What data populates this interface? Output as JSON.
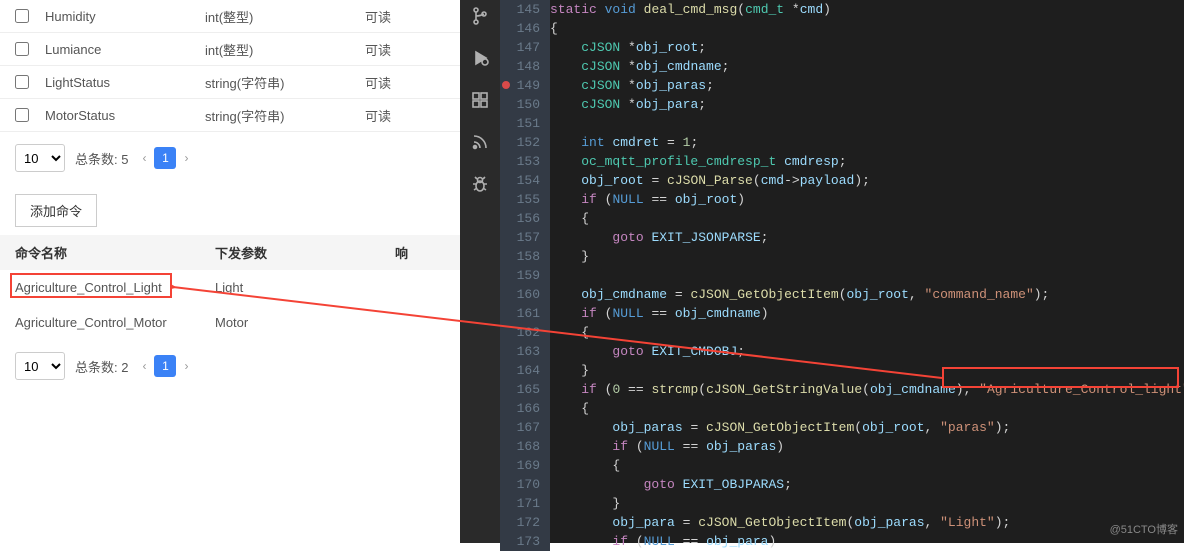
{
  "properties": [
    {
      "name": "Humidity",
      "type": "int(整型)",
      "mode": "可读"
    },
    {
      "name": "Lumiance",
      "type": "int(整型)",
      "mode": "可读"
    },
    {
      "name": "LightStatus",
      "type": "string(字符串)",
      "mode": "可读"
    },
    {
      "name": "MotorStatus",
      "type": "string(字符串)",
      "mode": "可读"
    }
  ],
  "prop_pager": {
    "size": "10",
    "label": "总条数: 5",
    "page": "1"
  },
  "add_cmd_label": "添加命令",
  "cmd_headers": {
    "h1": "命令名称",
    "h2": "下发参数",
    "h3": "响"
  },
  "commands": [
    {
      "name": "Agriculture_Control_Light",
      "param": "Light"
    },
    {
      "name": "Agriculture_Control_Motor",
      "param": "Motor"
    }
  ],
  "cmd_pager": {
    "size": "10",
    "label": "总条数: 2",
    "page": "1"
  },
  "sidebar_icons": [
    "branch",
    "debug",
    "extensions",
    "feed",
    "insect"
  ],
  "breakpoint_line": 149,
  "code": {
    "start": 145,
    "lines": [
      [
        [
          "k",
          "static"
        ],
        [
          "p",
          " "
        ],
        [
          "t",
          "void"
        ],
        [
          "p",
          " "
        ],
        [
          "fn",
          "deal_cmd_msg"
        ],
        [
          "p",
          "("
        ],
        [
          "st",
          "cmd_t"
        ],
        [
          "p",
          " *"
        ],
        [
          "id",
          "cmd"
        ],
        [
          "p",
          ")"
        ]
      ],
      [
        [
          "p",
          "{"
        ]
      ],
      [
        [
          "p",
          "    "
        ],
        [
          "st",
          "cJSON"
        ],
        [
          "p",
          " *"
        ],
        [
          "id",
          "obj_root"
        ],
        [
          "p",
          ";"
        ]
      ],
      [
        [
          "p",
          "    "
        ],
        [
          "st",
          "cJSON"
        ],
        [
          "p",
          " *"
        ],
        [
          "id",
          "obj_cmdname"
        ],
        [
          "p",
          ";"
        ]
      ],
      [
        [
          "p",
          "    "
        ],
        [
          "st",
          "cJSON"
        ],
        [
          "p",
          " *"
        ],
        [
          "id",
          "obj_paras"
        ],
        [
          "p",
          ";"
        ]
      ],
      [
        [
          "p",
          "    "
        ],
        [
          "st",
          "cJSON"
        ],
        [
          "p",
          " *"
        ],
        [
          "id",
          "obj_para"
        ],
        [
          "p",
          ";"
        ]
      ],
      [],
      [
        [
          "p",
          "    "
        ],
        [
          "t",
          "int"
        ],
        [
          "p",
          " "
        ],
        [
          "id",
          "cmdret"
        ],
        [
          "p",
          " = "
        ],
        [
          "n",
          "1"
        ],
        [
          "p",
          ";"
        ]
      ],
      [
        [
          "p",
          "    "
        ],
        [
          "st",
          "oc_mqtt_profile_cmdresp_t"
        ],
        [
          "p",
          " "
        ],
        [
          "id",
          "cmdresp"
        ],
        [
          "p",
          ";"
        ]
      ],
      [
        [
          "p",
          "    "
        ],
        [
          "id",
          "obj_root"
        ],
        [
          "p",
          " = "
        ],
        [
          "fn",
          "cJSON_Parse"
        ],
        [
          "p",
          "("
        ],
        [
          "id",
          "cmd"
        ],
        [
          "p",
          "->"
        ],
        [
          "id",
          "payload"
        ],
        [
          "p",
          ");"
        ]
      ],
      [
        [
          "p",
          "    "
        ],
        [
          "k",
          "if"
        ],
        [
          "p",
          " ("
        ],
        [
          "t",
          "NULL"
        ],
        [
          "p",
          " == "
        ],
        [
          "id",
          "obj_root"
        ],
        [
          "p",
          ")"
        ]
      ],
      [
        [
          "p",
          "    {"
        ]
      ],
      [
        [
          "p",
          "        "
        ],
        [
          "k",
          "goto"
        ],
        [
          "p",
          " "
        ],
        [
          "id",
          "EXIT_JSONPARSE"
        ],
        [
          "p",
          ";"
        ]
      ],
      [
        [
          "p",
          "    }"
        ]
      ],
      [],
      [
        [
          "p",
          "    "
        ],
        [
          "id",
          "obj_cmdname"
        ],
        [
          "p",
          " = "
        ],
        [
          "fn",
          "cJSON_GetObjectItem"
        ],
        [
          "p",
          "("
        ],
        [
          "id",
          "obj_root"
        ],
        [
          "p",
          ", "
        ],
        [
          "s",
          "\"command_name\""
        ],
        [
          "p",
          ");"
        ]
      ],
      [
        [
          "p",
          "    "
        ],
        [
          "k",
          "if"
        ],
        [
          "p",
          " ("
        ],
        [
          "t",
          "NULL"
        ],
        [
          "p",
          " == "
        ],
        [
          "id",
          "obj_cmdname"
        ],
        [
          "p",
          ")"
        ]
      ],
      [
        [
          "p",
          "    {"
        ]
      ],
      [
        [
          "p",
          "        "
        ],
        [
          "k",
          "goto"
        ],
        [
          "p",
          " "
        ],
        [
          "id",
          "EXIT_CMDOBJ"
        ],
        [
          "p",
          ";"
        ]
      ],
      [
        [
          "p",
          "    }"
        ]
      ],
      [
        [
          "p",
          "    "
        ],
        [
          "k",
          "if"
        ],
        [
          "p",
          " ("
        ],
        [
          "n",
          "0"
        ],
        [
          "p",
          " == "
        ],
        [
          "fn",
          "strcmp"
        ],
        [
          "p",
          "("
        ],
        [
          "fn",
          "cJSON_GetStringValue"
        ],
        [
          "p",
          "("
        ],
        [
          "id",
          "obj_cmdname"
        ],
        [
          "p",
          "), "
        ],
        [
          "s",
          "\"Agriculture_Control_light\""
        ],
        [
          "p",
          "))"
        ]
      ],
      [
        [
          "p",
          "    {"
        ]
      ],
      [
        [
          "p",
          "        "
        ],
        [
          "id",
          "obj_paras"
        ],
        [
          "p",
          " = "
        ],
        [
          "fn",
          "cJSON_GetObjectItem"
        ],
        [
          "p",
          "("
        ],
        [
          "id",
          "obj_root"
        ],
        [
          "p",
          ", "
        ],
        [
          "s",
          "\"paras\""
        ],
        [
          "p",
          ");"
        ]
      ],
      [
        [
          "p",
          "        "
        ],
        [
          "k",
          "if"
        ],
        [
          "p",
          " ("
        ],
        [
          "t",
          "NULL"
        ],
        [
          "p",
          " == "
        ],
        [
          "id",
          "obj_paras"
        ],
        [
          "p",
          ")"
        ]
      ],
      [
        [
          "p",
          "        {"
        ]
      ],
      [
        [
          "p",
          "            "
        ],
        [
          "k",
          "goto"
        ],
        [
          "p",
          " "
        ],
        [
          "id",
          "EXIT_OBJPARAS"
        ],
        [
          "p",
          ";"
        ]
      ],
      [
        [
          "p",
          "        }"
        ]
      ],
      [
        [
          "p",
          "        "
        ],
        [
          "id",
          "obj_para"
        ],
        [
          "p",
          " = "
        ],
        [
          "fn",
          "cJSON_GetObjectItem"
        ],
        [
          "p",
          "("
        ],
        [
          "id",
          "obj_paras"
        ],
        [
          "p",
          ", "
        ],
        [
          "s",
          "\"Light\""
        ],
        [
          "p",
          ");"
        ]
      ],
      [
        [
          "p",
          "        "
        ],
        [
          "k",
          "if"
        ],
        [
          "p",
          " ("
        ],
        [
          "t",
          "NULL"
        ],
        [
          "p",
          " == "
        ],
        [
          "id",
          "obj_para"
        ],
        [
          "p",
          ")"
        ]
      ]
    ]
  },
  "watermark": "@51CTO博客"
}
